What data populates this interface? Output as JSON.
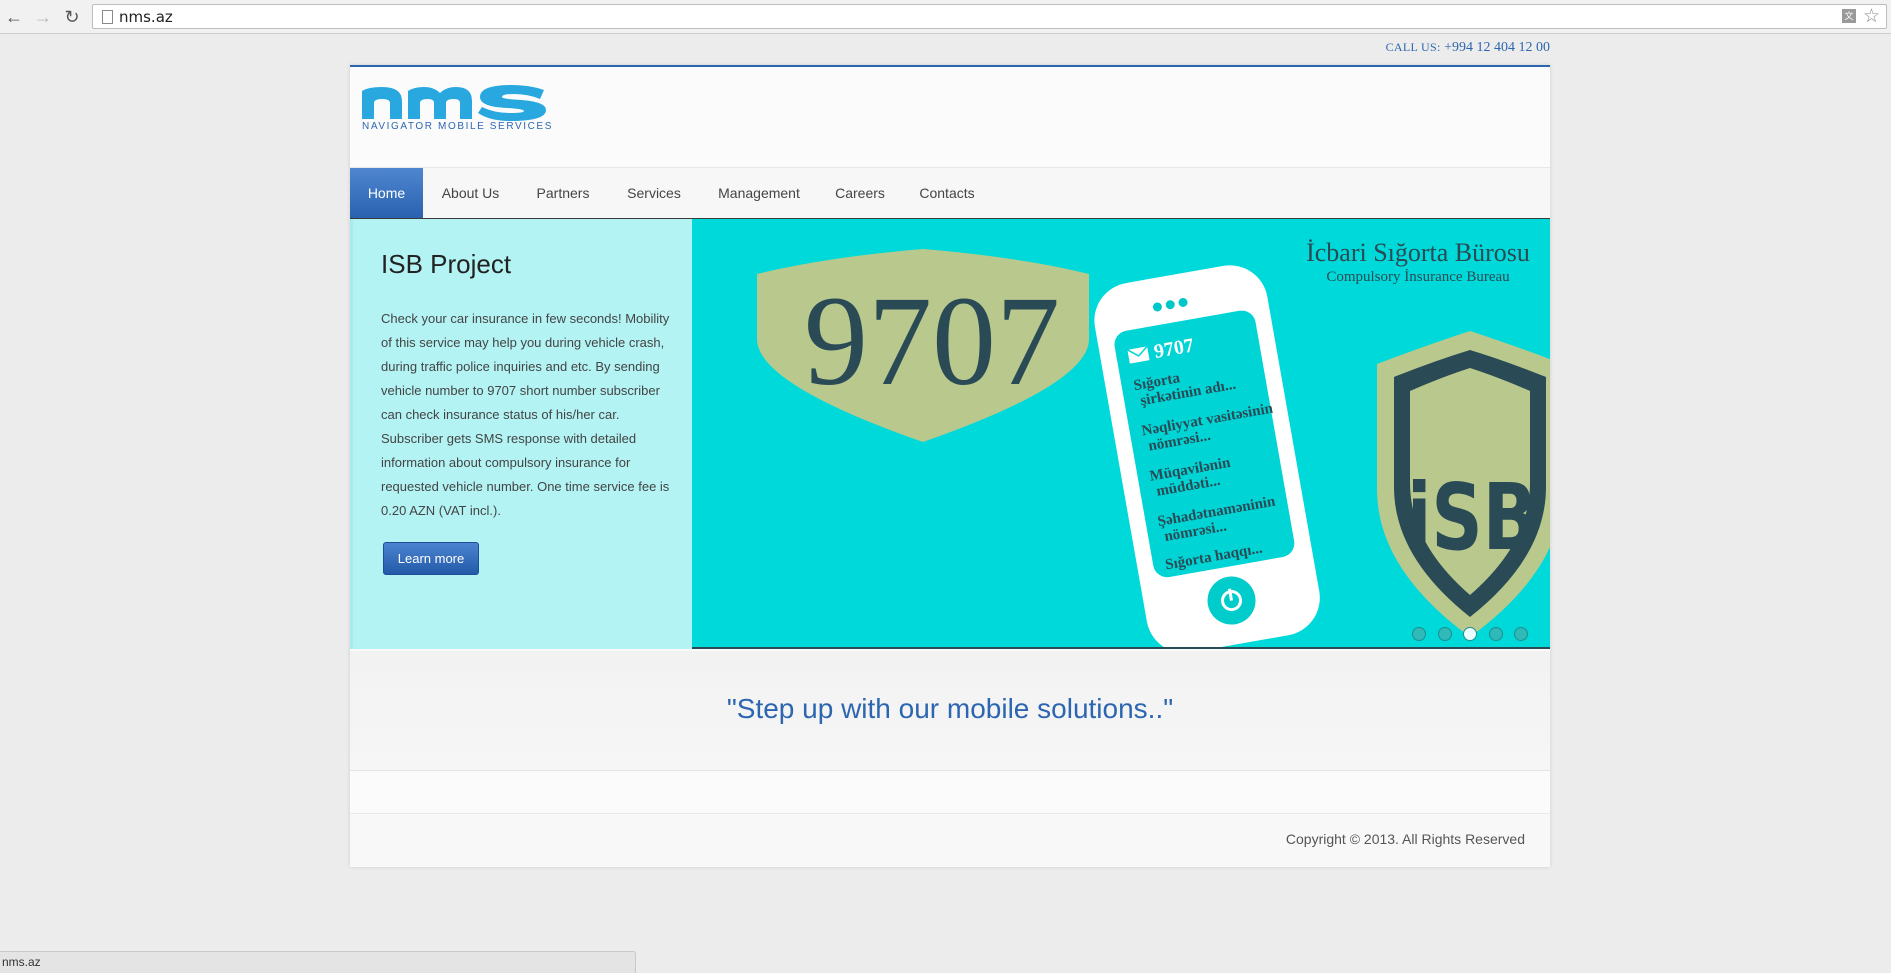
{
  "browser": {
    "url": "nms.az",
    "status_text": "nms.az"
  },
  "contact": {
    "label": "CALL US:",
    "phone": "+994 12 404 12 00"
  },
  "logo": {
    "wordmark": "nms",
    "tagline": "NAVIGATOR MOBILE SERVICES"
  },
  "menu": {
    "items": [
      {
        "label": "Home",
        "active": true
      },
      {
        "label": "About Us"
      },
      {
        "label": "Partners"
      },
      {
        "label": "Services"
      },
      {
        "label": "Management"
      },
      {
        "label": "Careers"
      },
      {
        "label": "Contacts"
      }
    ]
  },
  "intro": {
    "title": "ISB Project",
    "body": "Check your car insurance in few seconds! Mobility of this service may help you during vehicle crash, during traffic police inquiries and etc. By sending vehicle number to 9707 short number subscriber can check insurance status of his/her car. Subscriber gets SMS response with detailed information about compulsory insurance for requested vehicle number. One time service fee is 0.20 AZN (VAT incl.).",
    "button_label": "Learn more"
  },
  "slide": {
    "number": "9707",
    "bureau_name": "İcbari Sığorta Bürosu",
    "bureau_name_en": "Compulsory İnsurance Bureau",
    "sms_number": "9707",
    "phone_lines": [
      "Sığorta",
      "şirkətinin adı...",
      "Nəqliyyat vasitəsinin",
      "nömrəsi...",
      "Müqavilənin",
      "müddəti...",
      "Şəhadətnaməninin",
      "nömrəsi...",
      "Sığorta haqqı..."
    ],
    "badge": "iSB",
    "dots_total": 5,
    "dots_active": 3,
    "colors": {
      "background": "#00d9d9",
      "shield": "#b9c98d",
      "dark": "#2a4b55"
    }
  },
  "tagline": "\"Step up with our mobile solutions..\"",
  "footer": {
    "copyright": "Copyright © 2013. All Rights Reserved"
  },
  "colors": {
    "brand_blue": "#2d66b0",
    "logo_cyan": "#29a8e0"
  }
}
